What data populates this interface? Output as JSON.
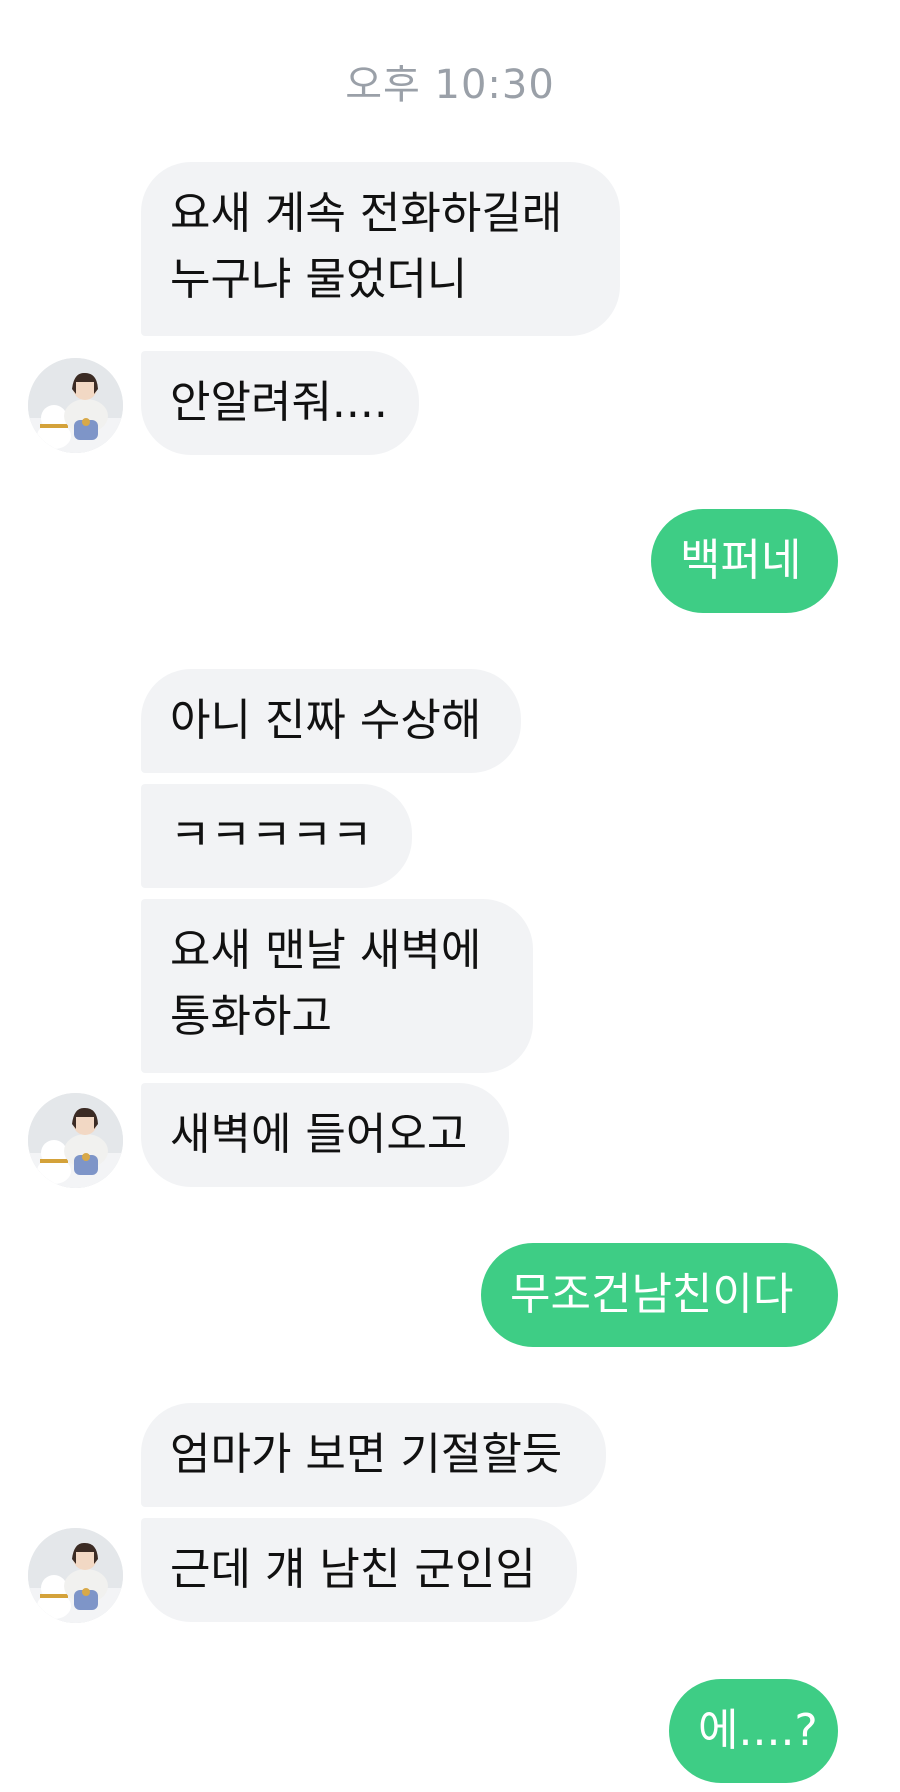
{
  "conversation": {
    "timestamp": "오후 10:30",
    "messages": [
      {
        "side": "received",
        "text": "요새 계속 전화하길래\n누구냐 물었더니"
      },
      {
        "side": "received",
        "text": "안알려줘...."
      },
      {
        "side": "sent",
        "text": "백퍼네"
      },
      {
        "side": "received",
        "text": "아니 진짜 수상해"
      },
      {
        "side": "received",
        "text": "ㅋㅋㅋㅋㅋ"
      },
      {
        "side": "received",
        "text": "요새 맨날 새벽에\n통화하고"
      },
      {
        "side": "received",
        "text": "새벽에 들어오고"
      },
      {
        "side": "sent",
        "text": "무조건남친이다"
      },
      {
        "side": "received",
        "text": "엄마가 보면 기절할듯"
      },
      {
        "side": "received",
        "text": "근데 걔 남친 군인임"
      },
      {
        "side": "sent",
        "text": "에....?"
      }
    ]
  },
  "avatar": {
    "icon": "profile-avatar-illustration"
  },
  "colors": {
    "sent_bubble": "#3ecd85",
    "received_bubble": "#f2f3f5",
    "timestamp_text": "#9aa0a8"
  }
}
